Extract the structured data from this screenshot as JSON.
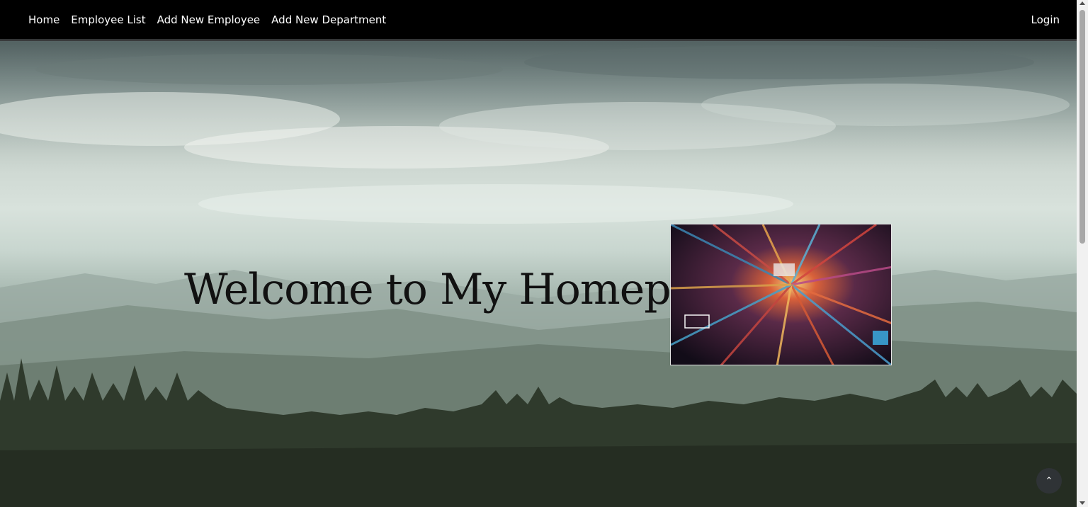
{
  "nav": {
    "items": [
      {
        "label": "Home"
      },
      {
        "label": "Employee List"
      },
      {
        "label": "Add New Employee"
      },
      {
        "label": "Add New Department"
      }
    ],
    "login_label": "Login"
  },
  "hero": {
    "title": "Welcome to My Homepage",
    "background_image": "misty-mountain-forest-landscape",
    "side_image": "city-aerial-night-image"
  },
  "scroll_top": {
    "icon": "chevron-up-icon",
    "glyph": "⌃"
  },
  "colors": {
    "navbar_bg": "#000000",
    "nav_text": "#ffffff",
    "title_text": "#111111",
    "scroll_button_bg": "#2f3336"
  }
}
